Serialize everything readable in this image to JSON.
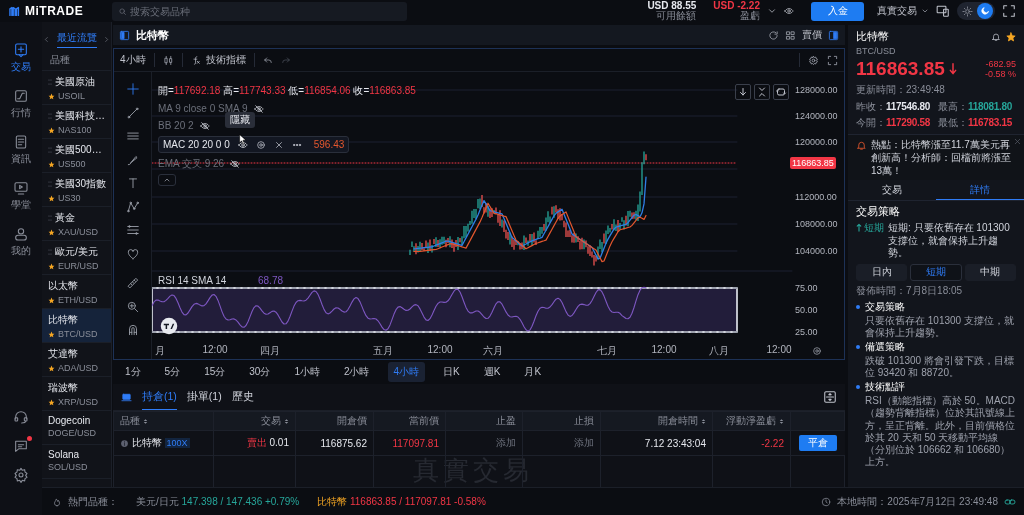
{
  "brand": {
    "name": "MiTRADE"
  },
  "search": {
    "placeholder": "搜索交易品种"
  },
  "account": {
    "balance": "USD 88.55",
    "balance_label": "可用餘額",
    "pnl": "USD -2.22",
    "pnl_label": "盈虧",
    "balance_visible": true,
    "deposit": "入金",
    "mode": "真實交易",
    "dark_theme": true
  },
  "nav": [
    {
      "label": "交易",
      "selected": true
    },
    {
      "label": "行情",
      "selected": false
    },
    {
      "label": "資訊",
      "selected": false
    },
    {
      "label": "學堂",
      "selected": false
    },
    {
      "label": "我的",
      "selected": false
    }
  ],
  "chat_unread": true,
  "watchlist": {
    "tab": "最近流覽",
    "column": "品種",
    "items": [
      {
        "name": "美國原油",
        "symbol": "USOIL",
        "starred": true,
        "draggable": true,
        "selected": false
      },
      {
        "name": "美國科技…",
        "symbol": "NAS100",
        "starred": true,
        "draggable": true,
        "selected": false
      },
      {
        "name": "美國500…",
        "symbol": "US500",
        "starred": true,
        "draggable": true,
        "selected": false
      },
      {
        "name": "美國30指數",
        "symbol": "US30",
        "starred": true,
        "draggable": true,
        "selected": false
      },
      {
        "name": "黃金",
        "symbol": "XAU/USD",
        "starred": true,
        "draggable": true,
        "selected": false
      },
      {
        "name": "歐元/美元",
        "symbol": "EUR/USD",
        "starred": true,
        "draggable": true,
        "selected": false
      },
      {
        "name": "以太幣",
        "symbol": "ETH/USD",
        "starred": true,
        "draggable": false,
        "selected": false
      },
      {
        "name": "比特幣",
        "symbol": "BTC/USD",
        "starred": true,
        "draggable": false,
        "selected": true
      },
      {
        "name": "艾達幣",
        "symbol": "ADA/USD",
        "starred": true,
        "draggable": false,
        "selected": false
      },
      {
        "name": "瑞波幣",
        "symbol": "XRP/USD",
        "starred": true,
        "draggable": false,
        "selected": false
      },
      {
        "name": "Dogecoin",
        "symbol": "DOGE/USD",
        "starred": false,
        "draggable": false,
        "selected": false
      },
      {
        "name": "Solana",
        "symbol": "SOL/USD",
        "starred": false,
        "draggable": false,
        "selected": false
      }
    ]
  },
  "instrument": {
    "title": "比特幣",
    "price_type": "賣價"
  },
  "toolbar": {
    "interval": "4小時",
    "indicators": "技術指標"
  },
  "chart": {
    "ohlc": [
      {
        "label": "開=",
        "value": "117692.18"
      },
      {
        "label": "高=",
        "value": "117743.33"
      },
      {
        "label": "低=",
        "value": "116854.06"
      },
      {
        "label": "收=",
        "value": "116863.85"
      }
    ],
    "indicators": [
      {
        "text": "MA 9 close 0 SMA 9",
        "visible": false,
        "hovered": false
      },
      {
        "text": "BB 20 2",
        "visible": false,
        "hovered": false
      },
      {
        "text": "MAC 20 20 0 0",
        "value": "596.43",
        "visible": true,
        "hovered": true
      },
      {
        "text": "EMA 交叉 9 26",
        "visible": false,
        "hovered": false
      }
    ],
    "tooltip": "隱藏",
    "price_axis": [
      "128000.00",
      "124000.00",
      "120000.00",
      "112000.00",
      "108000.00",
      "104000.00"
    ],
    "last_price": "116863.85",
    "rsi": {
      "label": "RSI 14 SMA 14",
      "value": "68.78",
      "axis": [
        "75.00",
        "50.00",
        "25.00"
      ]
    },
    "time_axis": [
      "月",
      "12:00",
      "四月",
      "五月",
      "12:00",
      "六月",
      "七月",
      "12:00",
      "八月",
      "12:00"
    ]
  },
  "timeframes": [
    {
      "label": "1分",
      "selected": false
    },
    {
      "label": "5分",
      "selected": false
    },
    {
      "label": "15分",
      "selected": false
    },
    {
      "label": "30分",
      "selected": false
    },
    {
      "label": "1小時",
      "selected": false
    },
    {
      "label": "2小時",
      "selected": false
    },
    {
      "label": "4小時",
      "selected": true
    },
    {
      "label": "日K",
      "selected": false
    },
    {
      "label": "週K",
      "selected": false
    },
    {
      "label": "月K",
      "selected": false
    }
  ],
  "positions": {
    "tabs": [
      {
        "label": "持倉(1)",
        "selected": true
      },
      {
        "label": "掛單(1)",
        "selected": false
      },
      {
        "label": "歷史",
        "selected": false
      }
    ],
    "columns": [
      {
        "label": "品種",
        "sortable": true
      },
      {
        "label": "交易",
        "sortable": true
      },
      {
        "label": "開倉價",
        "sortable": false
      },
      {
        "label": "當前價",
        "sortable": false
      },
      {
        "label": "止盈",
        "sortable": false
      },
      {
        "label": "止損",
        "sortable": false
      },
      {
        "label": "開倉時間",
        "sortable": true
      },
      {
        "label": "浮動淨盈虧",
        "sortable": true
      }
    ],
    "rows": [
      {
        "instrument": "比特幣",
        "leverage": "100X",
        "side": "賣出",
        "volume": "0.01",
        "open_price": "116875.62",
        "current_price": "117097.81",
        "take_profit": "添加",
        "stop_loss": "添加",
        "open_time": "7.12 23:43:04",
        "pnl": "-2.22",
        "close_button": "平倉"
      }
    ],
    "watermark": "真實交易"
  },
  "ticker": {
    "label": "熱門品種：",
    "items": [
      {
        "name": "美元/日元",
        "quote": "147.398 / 147.436 +0.79%",
        "rising": true,
        "highlight": false
      },
      {
        "name": "比特幣",
        "quote": "116863.85 / 117097.81 -0.58%",
        "rising": false,
        "highlight": true
      }
    ],
    "local_time": "本地時間：2025年7月12日 23:49:48"
  },
  "detail": {
    "title": "比特幣",
    "symbol": "BTC/USD",
    "alert_on": true,
    "favorite": true,
    "price": "116863.85",
    "falling": true,
    "change": "-682.95",
    "change_pct": "-0.58 %",
    "updated": "更新時間：23:49:48",
    "stats": [
      {
        "label": "昨收：",
        "value": "117546.80",
        "color": "#e6e8ee"
      },
      {
        "label": "最高：",
        "value": "118081.80",
        "color": "#26a69a"
      },
      {
        "label": "今開：",
        "value": "117290.58",
        "color": "#f23645"
      },
      {
        "label": "最低：",
        "value": "116783.15",
        "color": "#f23645"
      }
    ],
    "news": "熱點：比特幣漲至11.7萬美元再創新高！分析師：回檔前將漲至13萬！",
    "tabs": [
      {
        "label": "交易",
        "selected": false
      },
      {
        "label": "詳情",
        "selected": true
      }
    ],
    "strategy_title": "交易策略",
    "signal_tag": "短期",
    "signal_text": "短期: 只要依舊存在 101300 支撐位，就會保持上升趨勢。",
    "terms": [
      {
        "label": "日內",
        "selected": false
      },
      {
        "label": "短期",
        "selected": true
      },
      {
        "label": "中期",
        "selected": false
      }
    ],
    "published": "發佈時間：7月8日18:05",
    "sections": [
      {
        "title": "交易策略",
        "body": "只要依舊存在 101300 支撐位，就會保持上升趨勢。"
      },
      {
        "title": "備選策略",
        "body": "跌破 101300 將會引發下跌，目標位 93420 和 88720。"
      },
      {
        "title": "技術點評",
        "body": "RSI（動能指標）高於 50。MACD（趨勢背離指標）位於其訊號線上方，呈正背離。此外，目前價格位於其 20 天和 50 天移動平均線（分別位於 106662 和 106680）上方。"
      }
    ]
  }
}
